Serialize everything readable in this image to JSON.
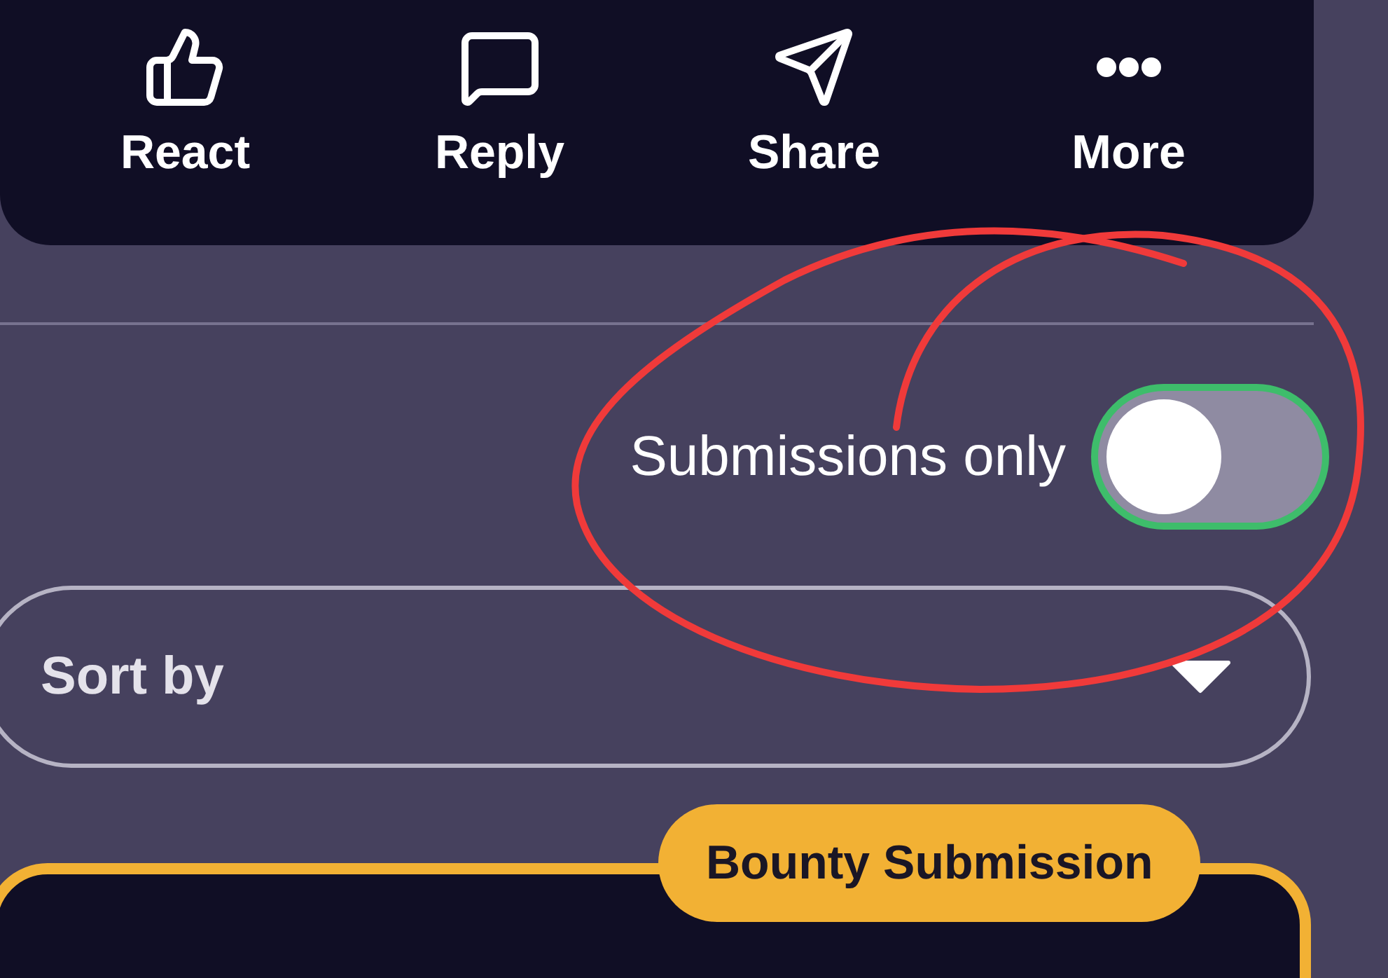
{
  "actions": [
    {
      "kind": "react",
      "label": "React"
    },
    {
      "kind": "reply",
      "label": "Reply"
    },
    {
      "kind": "share",
      "label": "Share"
    },
    {
      "kind": "more",
      "label": "More"
    }
  ],
  "filter_toggle": {
    "label": "Submissions only",
    "on": false
  },
  "sort": {
    "placeholder": "Sort by"
  },
  "post_card": {
    "badge": "Bounty Submission"
  },
  "annotation": {
    "kind": "circle",
    "color": "#f03a3a"
  }
}
